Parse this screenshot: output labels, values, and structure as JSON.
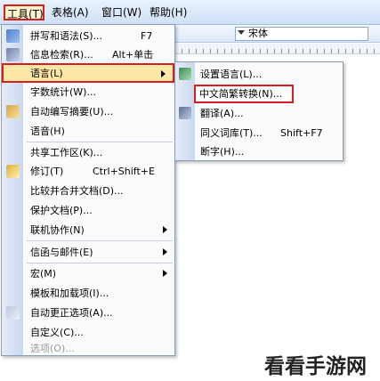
{
  "menubar": {
    "tools": "工具(T)",
    "table": "表格(A)",
    "window": "窗口(W)",
    "help": "帮助(H)"
  },
  "toolbar": {
    "font": "宋体"
  },
  "menu": {
    "items": [
      {
        "label": "拼写和语法(S)...",
        "shortcut": "F7"
      },
      {
        "label": "信息检索(R)...",
        "shortcut": "Alt+单击"
      },
      {
        "label": "语言(L)"
      },
      {
        "label": "字数统计(W)..."
      },
      {
        "label": "自动编写摘要(U)..."
      },
      {
        "label": "语音(H)"
      },
      {
        "label": "共享工作区(K)..."
      },
      {
        "label": "修订(T)",
        "shortcut": "Ctrl+Shift+E"
      },
      {
        "label": "比较并合并文档(D)..."
      },
      {
        "label": "保护文档(P)..."
      },
      {
        "label": "联机协作(N)"
      },
      {
        "label": "信函与邮件(E)"
      },
      {
        "label": "宏(M)"
      },
      {
        "label": "模板和加载项(I)..."
      },
      {
        "label": "自动更正选项(A)..."
      },
      {
        "label": "自定义(C)..."
      },
      {
        "label": "选项(O)..."
      }
    ]
  },
  "submenu": {
    "items": [
      {
        "label": "设置语言(L)..."
      },
      {
        "label": "中文简繁转换(N)..."
      },
      {
        "label": "翻译(A)..."
      },
      {
        "label": "同义词库(T)...",
        "shortcut": "Shift+F7"
      },
      {
        "label": "断字(H)..."
      }
    ]
  },
  "watermark": "看看手游网",
  "colors": {
    "highlight_border": "#d62020",
    "highlight_fill": "#fde8a8",
    "menubar_bg": "#cfe0f7"
  }
}
